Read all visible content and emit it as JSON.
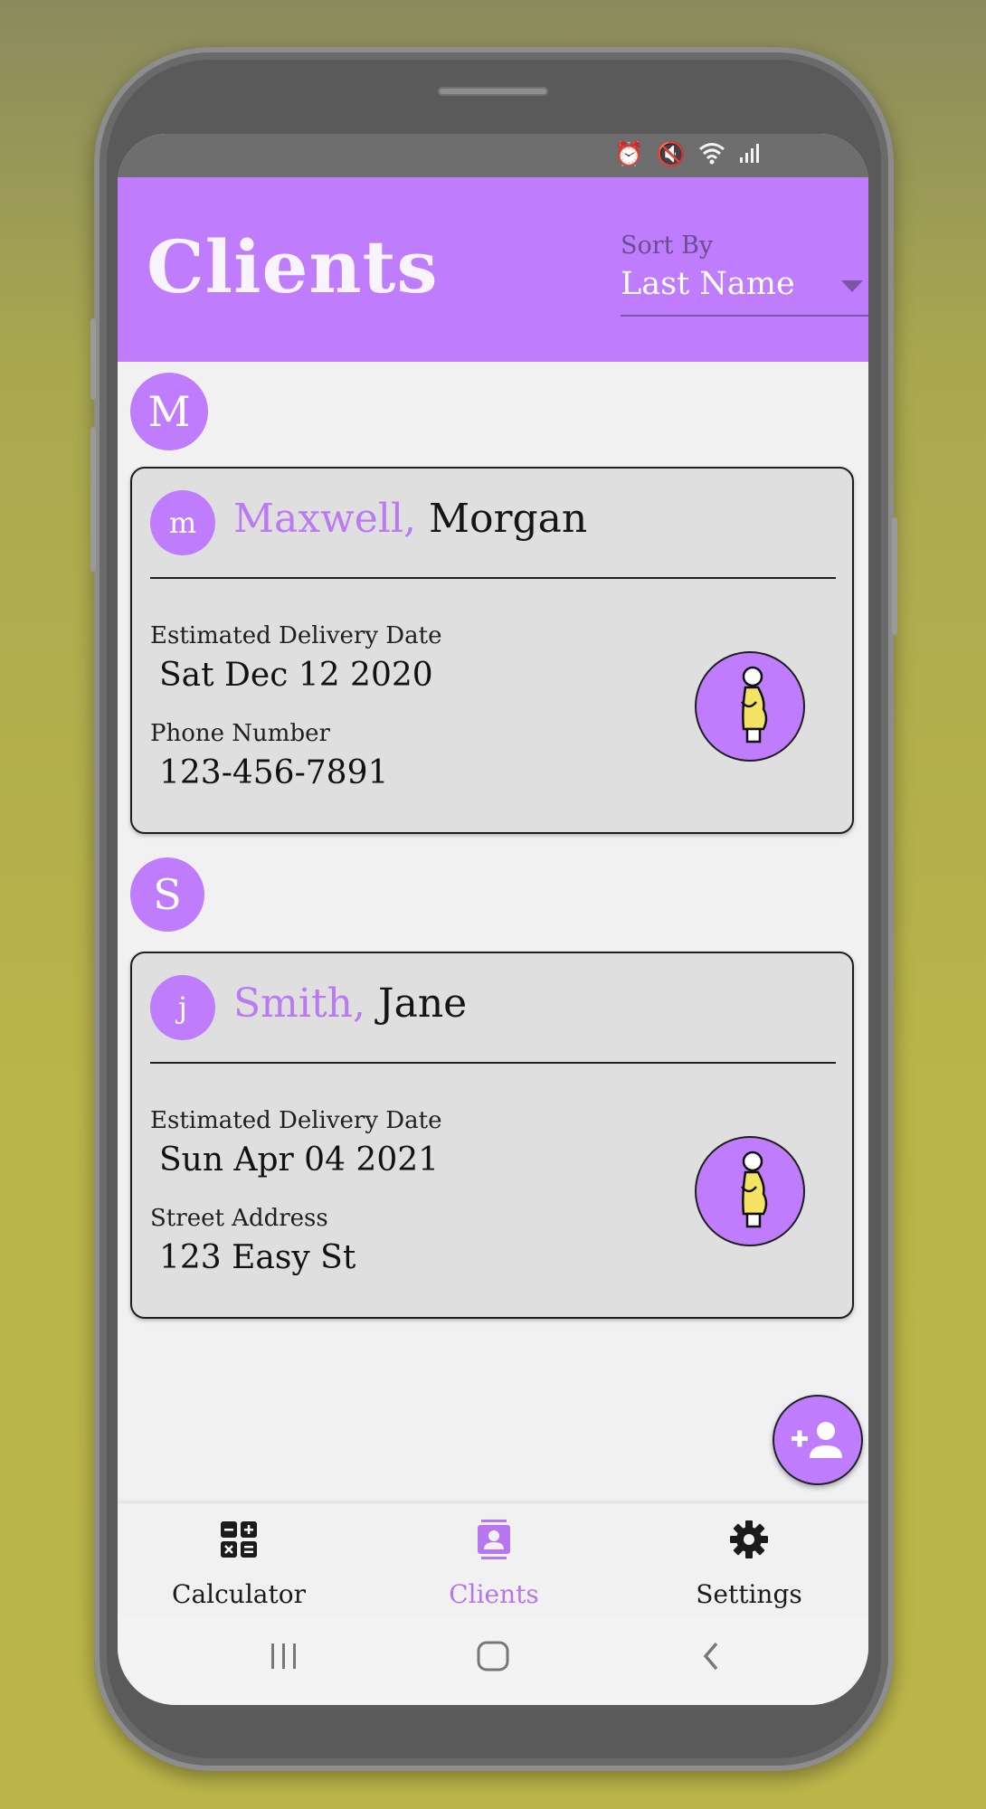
{
  "appbar": {
    "title": "Clients",
    "sort_label": "Sort By",
    "sort_value": "Last Name"
  },
  "colors": {
    "accent": "#bf7cfc",
    "last_name": "#bb7af2",
    "card_bg": "#dfdfdf",
    "icon_yellow": "#f5e463"
  },
  "sections": [
    {
      "letter": "M",
      "client": {
        "initial": "m",
        "last_name": "Maxwell,",
        "first_name": "Morgan",
        "field1_label": "Estimated Delivery Date",
        "field1_value": "Sat Dec 12 2020",
        "field2_label": "Phone Number",
        "field2_value": "123-456-7891",
        "icon": "pregnant-woman-icon"
      }
    },
    {
      "letter": "S",
      "client": {
        "initial": "j",
        "last_name": "Smith,",
        "first_name": "Jane",
        "field1_label": "Estimated Delivery Date",
        "field1_value": "Sun Apr 04 2021",
        "field2_label": "Street Address",
        "field2_value": "123 Easy St",
        "icon": "pregnant-woman-icon"
      }
    }
  ],
  "fab": {
    "icon": "add-person-icon"
  },
  "bottom_nav": [
    {
      "label": "Calculator",
      "icon": "calculator-icon",
      "active": false
    },
    {
      "label": "Clients",
      "icon": "contacts-icon",
      "active": true
    },
    {
      "label": "Settings",
      "icon": "gear-icon",
      "active": false
    }
  ],
  "system_nav": [
    "recents-icon",
    "home-icon",
    "back-icon"
  ]
}
